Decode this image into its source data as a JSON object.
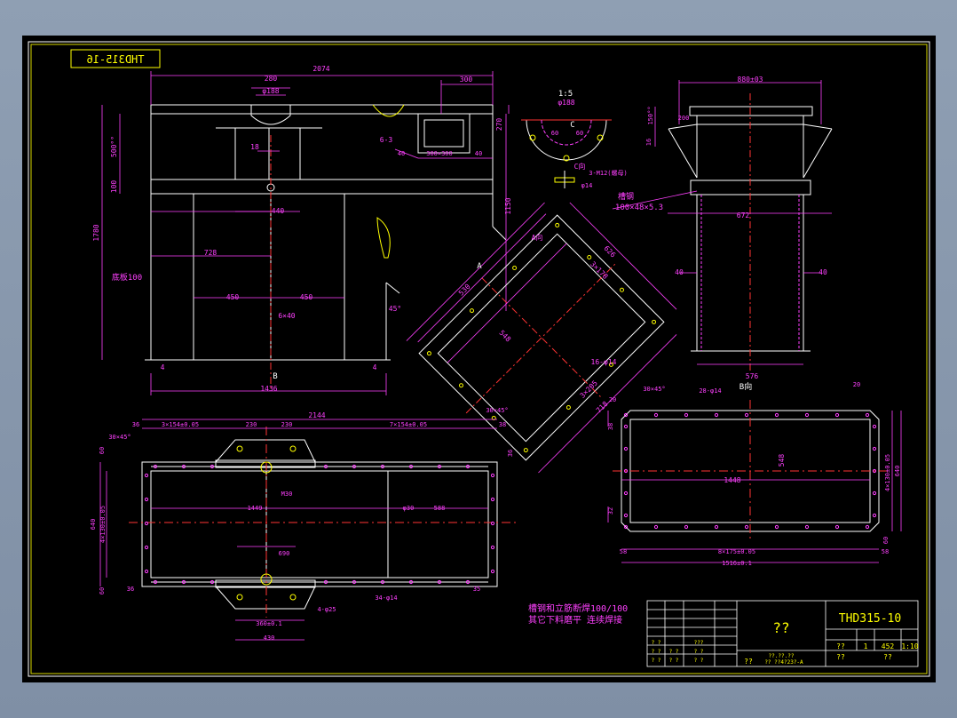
{
  "drawing": {
    "mirrored_tag": "THD315-16",
    "front_view": {
      "dims": {
        "total_length": "2074",
        "top_width": "280",
        "top_dia": "φ188",
        "opening": "300",
        "rib_offset": "18",
        "flange_height": "270",
        "height_500": "500°°",
        "height_100": "100",
        "height_1780": "1780",
        "height_1150": "1150",
        "hole_spacing": "440",
        "panel_728": "728",
        "half_a": "450",
        "half_b": "450",
        "thickness": "6×40",
        "bottom_length": "1436",
        "left_edge": "4",
        "right_edge": "4",
        "angle": "45°",
        "plate_note": "底板100",
        "port_size": "300×300",
        "port_w_a": "40",
        "port_w_b": "40",
        "port_holes": "6-3"
      },
      "view_b": "B"
    },
    "section_1_5": {
      "title": "1:5",
      "dia": "φ188",
      "angle_a": "60",
      "angle_b": "60",
      "label_c": "C",
      "c_view_label": "C向",
      "bolt_label": "3-M12(螺母)",
      "dia_small": "φ14"
    },
    "side_view": {
      "top_width": "880±03",
      "dim_150": "150°°",
      "dim_200": "200",
      "dim_16": "16",
      "channel_label": "槽钢",
      "channel_spec": "100×48×5.3",
      "inner_width": "672",
      "left_40": "40",
      "right_40": "40",
      "bottom_width": "576",
      "view_b_label": "B向"
    },
    "angled_view": {
      "label_a": "A向",
      "dim_626": "626",
      "dim_3x178": "3×178",
      "dim_530": "530",
      "dim_548": "548",
      "holes": "16-φ14",
      "dim_3x205": "3×205",
      "dim_718": "718",
      "marker_a": "A"
    },
    "plan_view": {
      "total": "2144",
      "left_pitch": "3×154±0.05",
      "mid_a": "230",
      "mid_b": "230",
      "right_pitch": "7×154±0.05",
      "chamfer_tr": "30×45°",
      "chamfer_tl": "30×45°",
      "edge_36_a": "36",
      "edge_36_b": "36",
      "edge_36_c": "36",
      "edge_38": "38",
      "edge_35": "35",
      "height_640": "640",
      "vert_pitch": "4×130±0.05",
      "edge_60_top": "60",
      "edge_60_bot": "60",
      "thread": "M30",
      "inner_len": "1449",
      "hole_dia": "φ30",
      "dim_588": "588",
      "dim_690": "690",
      "bolt_holes": "34-φ14",
      "small_holes": "4-φ25",
      "dim_360": "360±0.1",
      "dim_430": "430"
    },
    "b_view": {
      "chamfer": "30×45°",
      "holes": "28-φ14",
      "dim_20": "20",
      "height": "548",
      "length": "1448",
      "vert_pitch": "4×130±0.05",
      "total_h": "640",
      "left_38": "38",
      "left_32": "32",
      "bot_58_l": "58",
      "bot_58_r": "58",
      "bottom_pitch": "8×175±0.05",
      "bottom_total": "1516±0.1",
      "right_60": "60",
      "top_20": "20"
    },
    "notes": {
      "line1": "槽钢和立筋断焊100/100",
      "line2": "其它下料磨平 连续焊接"
    },
    "title_block": {
      "drawing_no": "THD315-10",
      "name": "??",
      "scale": "1:10",
      "weight": "452",
      "sheet": "1",
      "material_code": "??",
      "cell_78": "??",
      "cell_77": "??",
      "q_1": "? ?",
      "q_2": "? ?",
      "q_3": "? ?",
      "q_4": "? ?",
      "q_5": "???",
      "q_6": "? ?",
      "q_7": "? ?",
      "q_8": "? ?",
      "std_1": "??",
      "std_2": "??.??.??",
      "std_3": "?? ??4?23?-A"
    }
  }
}
